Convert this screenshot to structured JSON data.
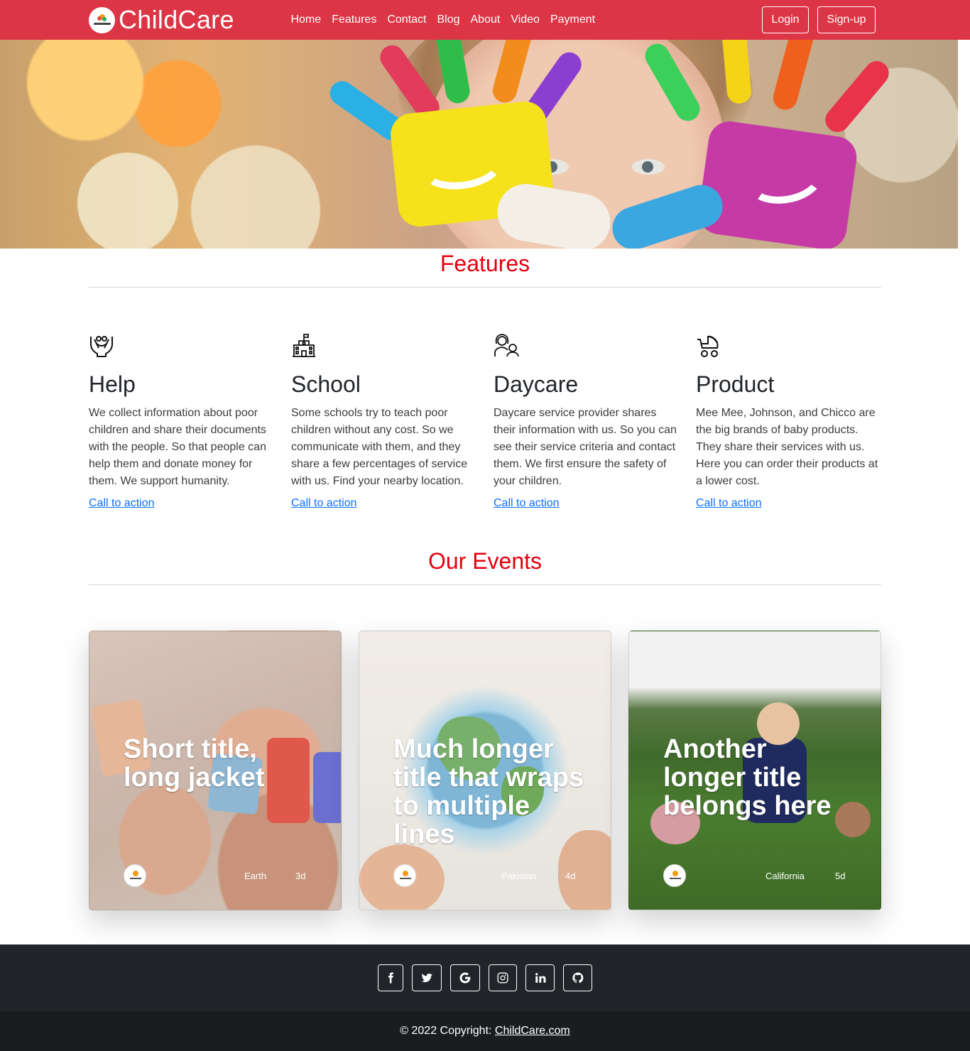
{
  "nav": {
    "brand": "ChildCare",
    "links": [
      "Home",
      "Features",
      "Contact",
      "Blog",
      "About",
      "Video",
      "Payment"
    ],
    "login": "Login",
    "signup": "Sign-up"
  },
  "features": {
    "title": "Features",
    "items": [
      {
        "icon": "helping-hands-icon",
        "title": "Help",
        "text": "We collect information about poor children and share their documents with the people. So that people can help them and donate money for them. We support humanity.",
        "link": "Call to action "
      },
      {
        "icon": "school-building-icon",
        "title": "School",
        "text": "Some schools try to teach poor children without any cost. So we communicate with them, and they share a few percentages of service with us. Find your nearby location.",
        "link": "Call to action "
      },
      {
        "icon": "parent-child-icon",
        "title": "Daycare",
        "text": "Daycare service provider shares their information with us. So you can see their service criteria and contact them. We first ensure the safety of your children.",
        "link": "Call to action "
      },
      {
        "icon": "baby-stroller-icon",
        "title": "Product",
        "text": "Mee Mee, Johnson, and Chicco are the big brands of baby products. They share their services with us. Here you can order their products at a lower cost.",
        "link": "Call to action "
      }
    ]
  },
  "events": {
    "title": "Our Events",
    "cards": [
      {
        "title": "Short title, long jacket",
        "location": "Earth",
        "days": "3d"
      },
      {
        "title": "Much longer title that wraps to multiple lines",
        "location": "Pakistan",
        "days": "4d"
      },
      {
        "title": "Another longer title belongs here",
        "location": "California",
        "days": "5d"
      }
    ]
  },
  "footer": {
    "social": [
      "facebook-icon",
      "twitter-icon",
      "google-icon",
      "instagram-icon",
      "linkedin-icon",
      "github-icon"
    ],
    "copyright_prefix": "© 2022 Copyright: ",
    "copyright_link": "ChildCare.com"
  },
  "colors": {
    "navbar": "#dc3545",
    "heading": "#e4000f",
    "link": "#0d6efd",
    "footer": "#212529"
  }
}
